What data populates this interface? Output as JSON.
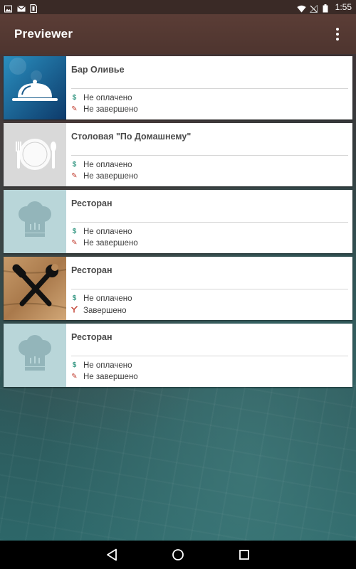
{
  "status_bar": {
    "time": "1:55",
    "left_icons": [
      "image-icon",
      "mail-icon",
      "sim-card-icon"
    ],
    "right_icons": [
      "wifi-icon",
      "no-signal-icon",
      "battery-icon"
    ]
  },
  "app_bar": {
    "title": "Previewer",
    "overflow_icon": "more-vert-icon"
  },
  "colors": {
    "app_bar": "#5b3d36",
    "status_bar": "#3a2a26",
    "paid_icon": "#3a9a86",
    "status_icon": "#c0392b"
  },
  "cards": [
    {
      "title": "Бар Оливье",
      "thumb": "cloche-icon",
      "payment": "Не оплачено",
      "payment_icon": "dollar-icon",
      "status": "Не завершено",
      "status_icon": "pencil-icon"
    },
    {
      "title": "Столовая \"По Домашнему\"",
      "thumb": "plate-cutlery-icon",
      "payment": "Не оплачено",
      "payment_icon": "dollar-icon",
      "status": "Не завершено",
      "status_icon": "pencil-icon"
    },
    {
      "title": "Ресторан",
      "thumb": "chef-hat-icon",
      "payment": "Не оплачено",
      "payment_icon": "dollar-icon",
      "status": "Не завершено",
      "status_icon": "pencil-icon"
    },
    {
      "title": "Ресторан",
      "thumb": "tools-icon",
      "payment": "Не оплачено",
      "payment_icon": "dollar-icon",
      "status": "Завершено",
      "status_icon": "check-icon"
    },
    {
      "title": "Ресторан",
      "thumb": "chef-hat-icon",
      "payment": "Не оплачено",
      "payment_icon": "dollar-icon",
      "status": "Не завершено",
      "status_icon": "pencil-icon"
    }
  ],
  "nav_bar": {
    "buttons": [
      "back-icon",
      "home-icon",
      "recents-icon"
    ]
  }
}
